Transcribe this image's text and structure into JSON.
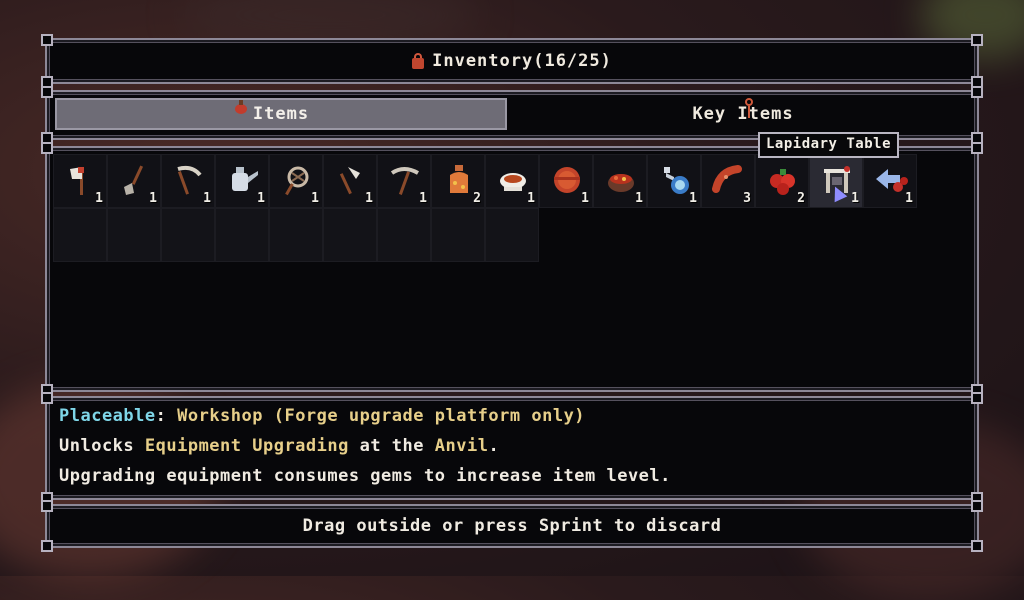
{
  "title": {
    "text": "Inventory(16/25)",
    "icon": "bag-icon"
  },
  "tabs": [
    {
      "label": "Items",
      "active": true,
      "icon": "tomato-icon"
    },
    {
      "label": "Key Items",
      "active": false,
      "icon": "key-icon"
    }
  ],
  "tooltip": {
    "text": "Lapidary Table"
  },
  "items": [
    {
      "icon": "axe-icon",
      "qty": "1"
    },
    {
      "icon": "shovel-icon",
      "qty": "1"
    },
    {
      "icon": "scythe-icon",
      "qty": "1"
    },
    {
      "icon": "watering-can-icon",
      "qty": "1"
    },
    {
      "icon": "net-icon",
      "qty": "1"
    },
    {
      "icon": "hoe-icon",
      "qty": "1"
    },
    {
      "icon": "pickaxe-icon",
      "qty": "1"
    },
    {
      "icon": "vase-icon",
      "qty": "2"
    },
    {
      "icon": "soup-bowl-icon",
      "qty": "1"
    },
    {
      "icon": "meat-icon",
      "qty": "1"
    },
    {
      "icon": "stew-bowl-icon",
      "qty": "1"
    },
    {
      "icon": "potion-icon",
      "qty": "1"
    },
    {
      "icon": "sausage-icon",
      "qty": "3"
    },
    {
      "icon": "berries-icon",
      "qty": "2"
    },
    {
      "icon": "lapidary-table-icon",
      "qty": "1"
    },
    {
      "icon": "cherries-icon",
      "qty": "1"
    }
  ],
  "empty_slots": 9,
  "description": {
    "line1": {
      "prefix": "Placeable",
      "sep": ": ",
      "value": "Workshop (Forge upgrade platform only)"
    },
    "line2": {
      "a": "Unlocks ",
      "b": "Equipment Upgrading",
      "c": " at the ",
      "d": "Anvil",
      "e": "."
    },
    "line3": "Upgrading equipment consumes gems to increase item level."
  },
  "footer": {
    "text": "Drag outside or press Sprint to discard"
  },
  "colors": {
    "accent_cyan": "#7fd6e8",
    "accent_gold": "#e7cf8a",
    "frame": "#8d8897"
  }
}
